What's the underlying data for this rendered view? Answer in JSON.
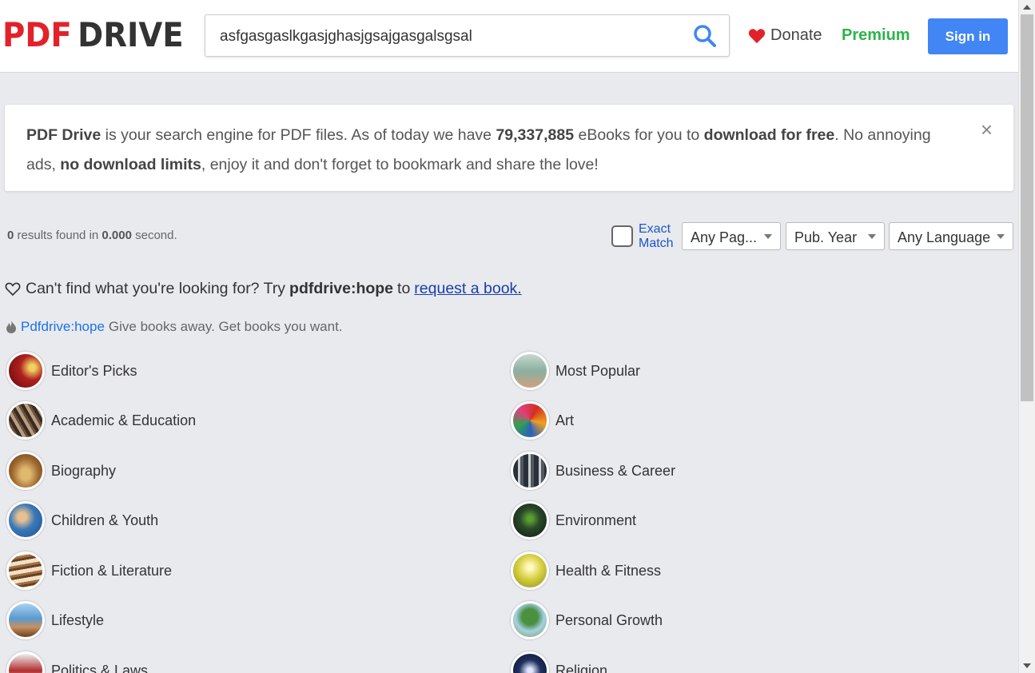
{
  "header": {
    "logo_pdf": "PDF",
    "logo_drive": "DRIVE",
    "search_value": "asfgasgaslkgasjghasjgsajgasgalsgsal",
    "donate": "Donate",
    "premium": "Premium",
    "signin": "Sign in"
  },
  "banner": {
    "brand": "PDF Drive",
    "t1": " is your search engine for PDF files. As of today we have ",
    "count": "79,337,885",
    "t2": " eBooks for you to ",
    "free": "download for free",
    "t3": ". No annoying ads, ",
    "limits": "no download limits",
    "t4": ", enjoy it and don't forget to bookmark and share the love!",
    "close": "×"
  },
  "results": {
    "count": "0",
    "t1": " results found in ",
    "time": "0.000",
    "t2": " second."
  },
  "filters": {
    "exact_match": "Exact Match",
    "pages": "Any Pag...",
    "year": "Pub. Year",
    "language": "Any Language"
  },
  "request": {
    "t1": "Can't find what you're looking for? Try",
    "keyword": "pdfdrive:hope",
    "t2": "to",
    "link": "request a book."
  },
  "hope": {
    "link": "Pdfdrive:hope",
    "text": "Give books away. Get books you want."
  },
  "categories": {
    "left": [
      {
        "label": "Editor's Picks",
        "color": "#9b1b1b"
      },
      {
        "label": "Academic & Education",
        "color": "#6b5040"
      },
      {
        "label": "Biography",
        "color": "#b08040"
      },
      {
        "label": "Children & Youth",
        "color": "#3a78b8"
      },
      {
        "label": "Fiction & Literature",
        "color": "#c09060"
      },
      {
        "label": "Lifestyle",
        "color": "#5a9ad0"
      },
      {
        "label": "Politics & Laws",
        "color": "#b03030"
      }
    ],
    "right": [
      {
        "label": "Most Popular",
        "color": "#8ab0a0"
      },
      {
        "label": "Art",
        "color": "#d05030"
      },
      {
        "label": "Business & Career",
        "color": "#404850"
      },
      {
        "label": "Environment",
        "color": "#2a4a2a"
      },
      {
        "label": "Health & Fitness",
        "color": "#d8d040"
      },
      {
        "label": "Personal Growth",
        "color": "#3a8030"
      },
      {
        "label": "Religion",
        "color": "#203060"
      }
    ]
  }
}
